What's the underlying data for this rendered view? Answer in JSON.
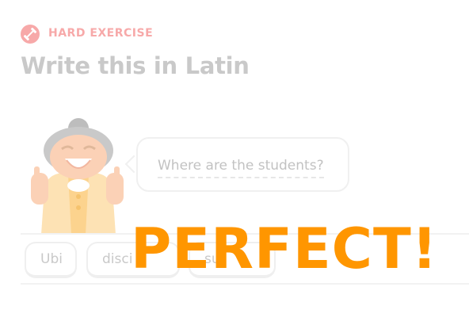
{
  "header": {
    "badge_label": "HARD EXERCISE",
    "badge_icon": "dumbbell-icon",
    "title": "Write this in Latin"
  },
  "prompt": {
    "text": "Where are the students?"
  },
  "word_bank": [
    {
      "label": "Ubi"
    },
    {
      "label": "disci"
    },
    {
      "label": "su"
    }
  ],
  "feedback": {
    "text": "PERFECT!"
  },
  "colors": {
    "badge": "#f7a9a9",
    "title": "#c9c9c9",
    "feedback": "#ff9600"
  }
}
